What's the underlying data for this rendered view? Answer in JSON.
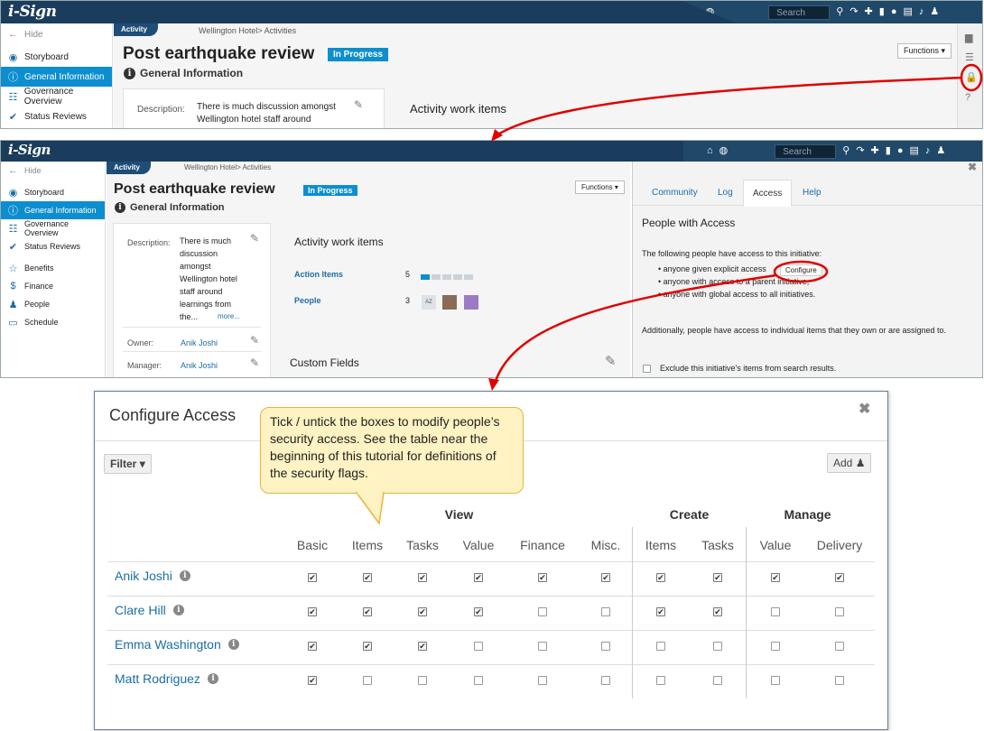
{
  "app": {
    "logo": "i-Sign",
    "search_placeholder": "Search",
    "hide_label": "Hide",
    "activity_tab": "Activity",
    "breadcrumb": "Wellington Hotel> Activities",
    "page_title": "Post earthquake review",
    "status": "In Progress",
    "section_title": "General Information",
    "functions_label": "Functions",
    "activity_work_items": "Activity work items",
    "custom_fields": "Custom Fields"
  },
  "sidebar": {
    "items": [
      {
        "label": "Storyboard",
        "icon": "storyboard-icon"
      },
      {
        "label": "General Information",
        "icon": "info-icon"
      },
      {
        "label": "Governance Overview",
        "icon": "governance-icon"
      },
      {
        "label": "Status Reviews",
        "icon": "check-icon"
      },
      {
        "label": "Benefits",
        "icon": "star-icon"
      },
      {
        "label": "Finance",
        "icon": "dollar-icon"
      },
      {
        "label": "People",
        "icon": "people-icon"
      },
      {
        "label": "Schedule",
        "icon": "schedule-icon"
      }
    ]
  },
  "general": {
    "description_label": "Description:",
    "description_short": "There is much discussion amongst Wellington hotel staff around",
    "description_lines": [
      "There is much",
      "discussion",
      "amongst",
      "Wellington hotel",
      "staff around",
      "learnings from",
      "the..."
    ],
    "more": "more...",
    "owner_label": "Owner:",
    "owner": "Anik Joshi",
    "manager_label": "Manager:",
    "manager": "Anik Joshi"
  },
  "work_items": {
    "action_items_label": "Action Items",
    "action_items_count": "5",
    "action_items_progress": 0.2,
    "people_label": "People",
    "people_count": "3",
    "avatar_initials": "AZ"
  },
  "right_panel": {
    "tabs": [
      "Community",
      "Log",
      "Access",
      "Help"
    ],
    "active_tab": "Access",
    "heading": "People with Access",
    "intro": "The following people have access to this initiative:",
    "bullets": [
      "anyone given explicit access",
      "anyone with access to a parent initiative,",
      "anyone with global access to all initiatives."
    ],
    "configure": "Configure",
    "additional": "Additionally, people have access to individual items that they own or are assigned to.",
    "exclude": "Exclude this initiative's items from search results."
  },
  "configure_access": {
    "title": "Configure Access",
    "filter_label": "Filter",
    "add_label": "Add",
    "callout": "Tick / untick the boxes to modify people’s security access.  See the table near the beginning of this tutorial for definitions of the security flags.",
    "groups": [
      "View",
      "Create",
      "Manage"
    ],
    "columns": [
      "Basic",
      "Items",
      "Tasks",
      "Value",
      "Finance",
      "Misc.",
      "Items",
      "Tasks",
      "Value",
      "Delivery"
    ],
    "rows": [
      {
        "name": "Anik Joshi",
        "flags": [
          true,
          true,
          true,
          true,
          true,
          true,
          true,
          true,
          true,
          true
        ]
      },
      {
        "name": "Clare Hill",
        "flags": [
          true,
          true,
          true,
          true,
          false,
          false,
          true,
          true,
          false,
          false
        ]
      },
      {
        "name": "Emma Washington",
        "flags": [
          true,
          true,
          true,
          false,
          false,
          false,
          false,
          false,
          false,
          false
        ]
      },
      {
        "name": "Matt Rodriguez",
        "flags": [
          true,
          false,
          false,
          false,
          false,
          false,
          false,
          false,
          false,
          false
        ]
      }
    ]
  },
  "colors": {
    "topbar": "#1b3d5d",
    "accent": "#0d8ecf",
    "link": "#1b6ea5",
    "annotation": "#e00000",
    "callout_fill": "#fff2c3"
  }
}
